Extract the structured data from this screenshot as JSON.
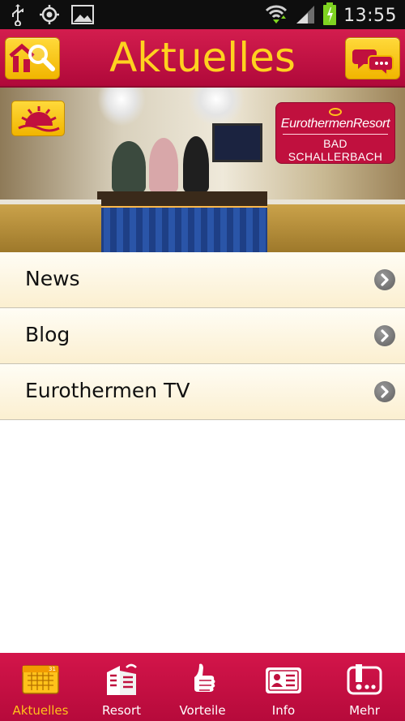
{
  "status_bar": {
    "time": "13:55",
    "icons": [
      "usb-icon",
      "gps-icon",
      "image-icon",
      "wifi-icon",
      "signal-icon",
      "battery-icon"
    ]
  },
  "header": {
    "title": "Aktuelles",
    "left_button_icon": "home-search-icon",
    "right_button_icon": "chat-icon"
  },
  "banner": {
    "badge_icon": "sun-icon",
    "logo_line1": "EurothermenResort",
    "logo_line2": "BAD SCHALLERBACH"
  },
  "list": {
    "items": [
      {
        "label": "News"
      },
      {
        "label": "Blog"
      },
      {
        "label": "Eurothermen TV"
      }
    ]
  },
  "tabbar": {
    "tabs": [
      {
        "label": "Aktuelles",
        "icon": "calendar-icon",
        "active": true
      },
      {
        "label": "Resort",
        "icon": "building-icon",
        "active": false
      },
      {
        "label": "Vorteile",
        "icon": "thumbs-up-icon",
        "active": false
      },
      {
        "label": "Info",
        "icon": "id-card-icon",
        "active": false
      },
      {
        "label": "Mehr",
        "icon": "more-icon",
        "active": false
      }
    ]
  },
  "colors": {
    "brand_red": "#c0103e",
    "accent_yellow": "#ffc21a",
    "list_background": "#fdf3d9"
  }
}
